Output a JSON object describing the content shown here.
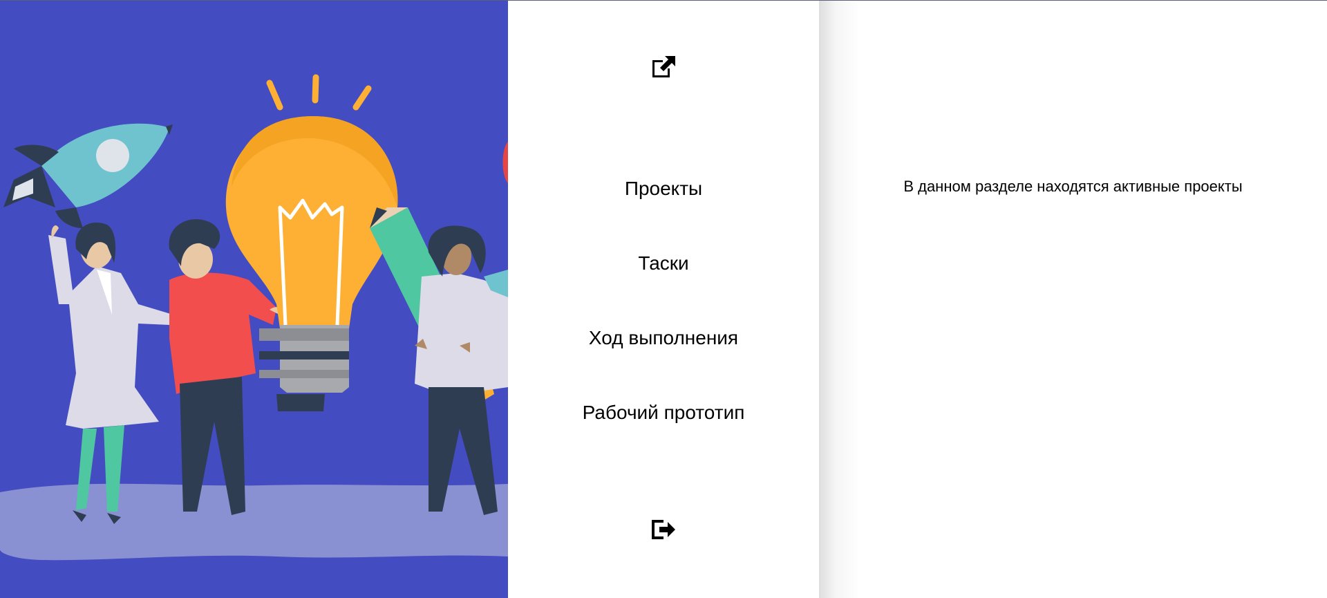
{
  "hero": {
    "illustration": "people-with-lightbulb-rocket-pencil",
    "colors": {
      "background": "#434cc1",
      "ground": "#8a91d3",
      "bulb": "#fdb034",
      "rocket": "#6fc3ce",
      "pencil": "#4fc7a0",
      "shirt_red": "#f34e4e",
      "dark": "#2f3d52"
    }
  },
  "sidebar": {
    "top_icon": "external-link-icon",
    "nav_items": [
      {
        "label": "Проекты"
      },
      {
        "label": "Таски"
      },
      {
        "label": "Ход выполнения"
      },
      {
        "label": "Рабочий прототип"
      }
    ],
    "bottom_icon": "logout-icon"
  },
  "content": {
    "description": "В данном разделе находятся активные проекты"
  }
}
